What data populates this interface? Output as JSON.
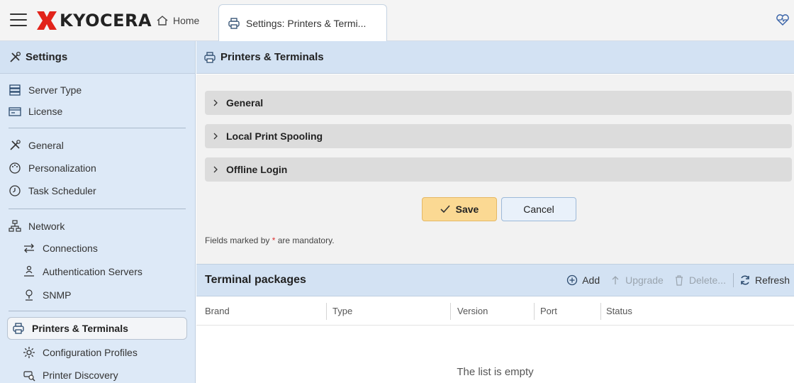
{
  "app": {
    "brand": "KYOCERA",
    "home_tab": "Home",
    "active_tab": "Settings: Printers & Termi..."
  },
  "sidebar": {
    "title": "Settings",
    "items": [
      {
        "label": "Server Type",
        "icon": "server-icon"
      },
      {
        "label": "License",
        "icon": "license-icon"
      },
      {
        "label": "General",
        "icon": "tools-icon"
      },
      {
        "label": "Personalization",
        "icon": "palette-icon"
      },
      {
        "label": "Task Scheduler",
        "icon": "clock-icon"
      },
      {
        "label": "Network",
        "icon": "network-icon"
      },
      {
        "label": "Connections",
        "icon": "arrows-icon"
      },
      {
        "label": "Authentication Servers",
        "icon": "auth-server-icon"
      },
      {
        "label": "SNMP",
        "icon": "snmp-icon"
      },
      {
        "label": "Printers & Terminals",
        "icon": "printer-icon",
        "active": true
      },
      {
        "label": "Configuration Profiles",
        "icon": "gear-icon"
      },
      {
        "label": "Printer Discovery",
        "icon": "printer-search-icon"
      }
    ]
  },
  "main": {
    "title": "Printers & Terminals",
    "sections": [
      "General",
      "Local Print Spooling",
      "Offline Login"
    ],
    "save_label": "Save",
    "cancel_label": "Cancel",
    "mandatory_prefix": "Fields marked by ",
    "mandatory_star": "*",
    "mandatory_suffix": " are mandatory."
  },
  "terminal_packages": {
    "title": "Terminal packages",
    "actions": {
      "add": "Add",
      "upgrade": "Upgrade",
      "delete": "Delete...",
      "refresh": "Refresh"
    },
    "columns": [
      "Brand",
      "Type",
      "Version",
      "Port",
      "Status"
    ],
    "empty_text": "The list is empty"
  },
  "colors": {
    "accent": "#fbd993",
    "header_bg": "#d3e2f3",
    "sidebar_bg": "#dde9f7",
    "logo_red": "#e2231a"
  }
}
